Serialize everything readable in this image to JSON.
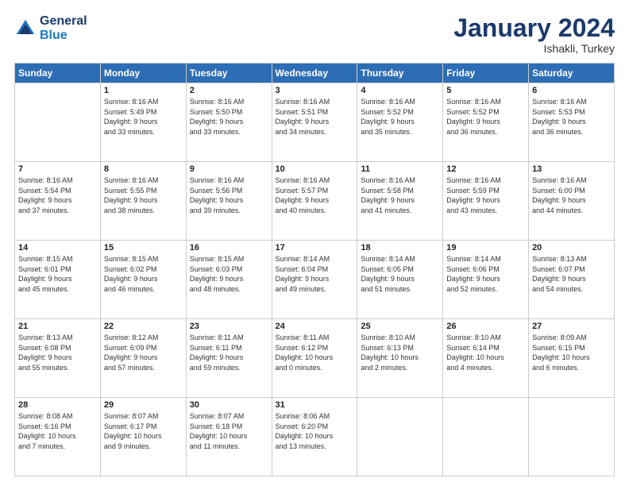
{
  "logo": {
    "line1": "General",
    "line2": "Blue"
  },
  "title": "January 2024",
  "subtitle": "Ishakli, Turkey",
  "days_of_week": [
    "Sunday",
    "Monday",
    "Tuesday",
    "Wednesday",
    "Thursday",
    "Friday",
    "Saturday"
  ],
  "weeks": [
    [
      {
        "day": "",
        "info": ""
      },
      {
        "day": "1",
        "info": "Sunrise: 8:16 AM\nSunset: 5:49 PM\nDaylight: 9 hours\nand 33 minutes."
      },
      {
        "day": "2",
        "info": "Sunrise: 8:16 AM\nSunset: 5:50 PM\nDaylight: 9 hours\nand 33 minutes."
      },
      {
        "day": "3",
        "info": "Sunrise: 8:16 AM\nSunset: 5:51 PM\nDaylight: 9 hours\nand 34 minutes."
      },
      {
        "day": "4",
        "info": "Sunrise: 8:16 AM\nSunset: 5:52 PM\nDaylight: 9 hours\nand 35 minutes."
      },
      {
        "day": "5",
        "info": "Sunrise: 8:16 AM\nSunset: 5:52 PM\nDaylight: 9 hours\nand 36 minutes."
      },
      {
        "day": "6",
        "info": "Sunrise: 8:16 AM\nSunset: 5:53 PM\nDaylight: 9 hours\nand 36 minutes."
      }
    ],
    [
      {
        "day": "7",
        "info": "Sunrise: 8:16 AM\nSunset: 5:54 PM\nDaylight: 9 hours\nand 37 minutes."
      },
      {
        "day": "8",
        "info": "Sunrise: 8:16 AM\nSunset: 5:55 PM\nDaylight: 9 hours\nand 38 minutes."
      },
      {
        "day": "9",
        "info": "Sunrise: 8:16 AM\nSunset: 5:56 PM\nDaylight: 9 hours\nand 39 minutes."
      },
      {
        "day": "10",
        "info": "Sunrise: 8:16 AM\nSunset: 5:57 PM\nDaylight: 9 hours\nand 40 minutes."
      },
      {
        "day": "11",
        "info": "Sunrise: 8:16 AM\nSunset: 5:58 PM\nDaylight: 9 hours\nand 41 minutes."
      },
      {
        "day": "12",
        "info": "Sunrise: 8:16 AM\nSunset: 5:59 PM\nDaylight: 9 hours\nand 43 minutes."
      },
      {
        "day": "13",
        "info": "Sunrise: 8:16 AM\nSunset: 6:00 PM\nDaylight: 9 hours\nand 44 minutes."
      }
    ],
    [
      {
        "day": "14",
        "info": "Sunrise: 8:15 AM\nSunset: 6:01 PM\nDaylight: 9 hours\nand 45 minutes."
      },
      {
        "day": "15",
        "info": "Sunrise: 8:15 AM\nSunset: 6:02 PM\nDaylight: 9 hours\nand 46 minutes."
      },
      {
        "day": "16",
        "info": "Sunrise: 8:15 AM\nSunset: 6:03 PM\nDaylight: 9 hours\nand 48 minutes."
      },
      {
        "day": "17",
        "info": "Sunrise: 8:14 AM\nSunset: 6:04 PM\nDaylight: 9 hours\nand 49 minutes."
      },
      {
        "day": "18",
        "info": "Sunrise: 8:14 AM\nSunset: 6:05 PM\nDaylight: 9 hours\nand 51 minutes."
      },
      {
        "day": "19",
        "info": "Sunrise: 8:14 AM\nSunset: 6:06 PM\nDaylight: 9 hours\nand 52 minutes."
      },
      {
        "day": "20",
        "info": "Sunrise: 8:13 AM\nSunset: 6:07 PM\nDaylight: 9 hours\nand 54 minutes."
      }
    ],
    [
      {
        "day": "21",
        "info": "Sunrise: 8:13 AM\nSunset: 6:08 PM\nDaylight: 9 hours\nand 55 minutes."
      },
      {
        "day": "22",
        "info": "Sunrise: 8:12 AM\nSunset: 6:09 PM\nDaylight: 9 hours\nand 57 minutes."
      },
      {
        "day": "23",
        "info": "Sunrise: 8:11 AM\nSunset: 6:11 PM\nDaylight: 9 hours\nand 59 minutes."
      },
      {
        "day": "24",
        "info": "Sunrise: 8:11 AM\nSunset: 6:12 PM\nDaylight: 10 hours\nand 0 minutes."
      },
      {
        "day": "25",
        "info": "Sunrise: 8:10 AM\nSunset: 6:13 PM\nDaylight: 10 hours\nand 2 minutes."
      },
      {
        "day": "26",
        "info": "Sunrise: 8:10 AM\nSunset: 6:14 PM\nDaylight: 10 hours\nand 4 minutes."
      },
      {
        "day": "27",
        "info": "Sunrise: 8:09 AM\nSunset: 6:15 PM\nDaylight: 10 hours\nand 6 minutes."
      }
    ],
    [
      {
        "day": "28",
        "info": "Sunrise: 8:08 AM\nSunset: 6:16 PM\nDaylight: 10 hours\nand 7 minutes."
      },
      {
        "day": "29",
        "info": "Sunrise: 8:07 AM\nSunset: 6:17 PM\nDaylight: 10 hours\nand 9 minutes."
      },
      {
        "day": "30",
        "info": "Sunrise: 8:07 AM\nSunset: 6:18 PM\nDaylight: 10 hours\nand 11 minutes."
      },
      {
        "day": "31",
        "info": "Sunrise: 8:06 AM\nSunset: 6:20 PM\nDaylight: 10 hours\nand 13 minutes."
      },
      {
        "day": "",
        "info": ""
      },
      {
        "day": "",
        "info": ""
      },
      {
        "day": "",
        "info": ""
      }
    ]
  ]
}
